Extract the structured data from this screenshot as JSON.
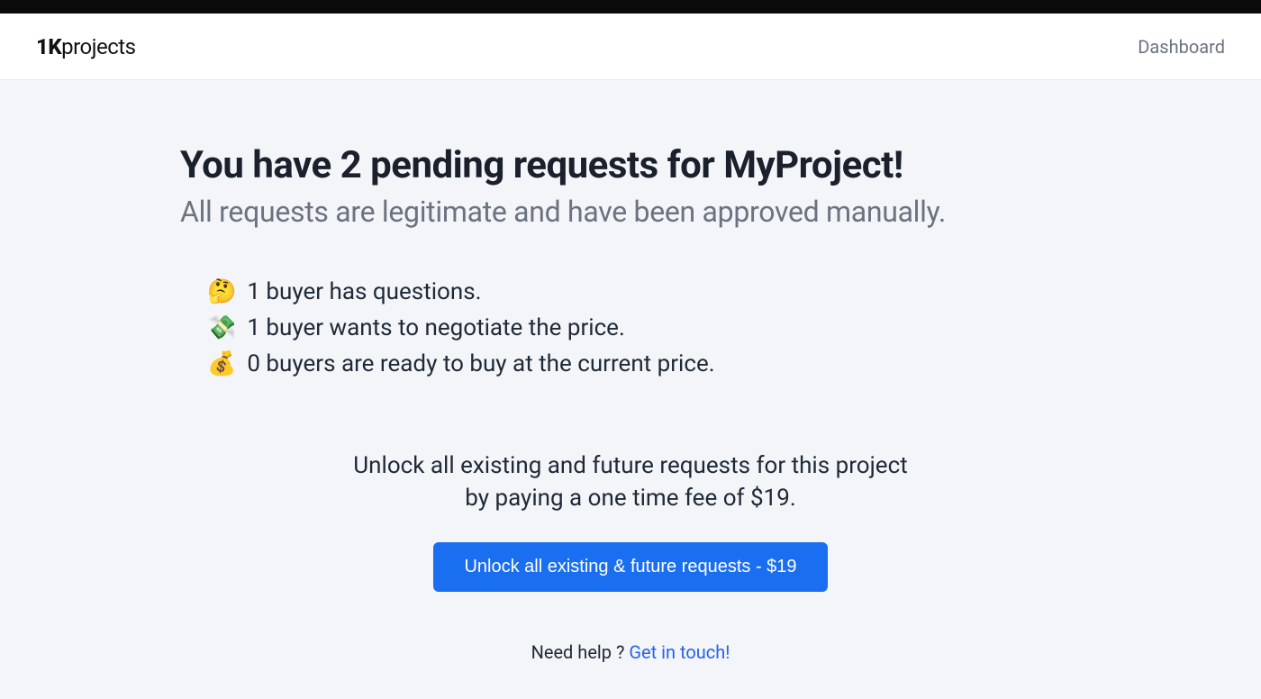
{
  "header": {
    "logo_bold": "1K",
    "logo_rest": "projects",
    "nav": {
      "dashboard": "Dashboard"
    }
  },
  "page": {
    "title": "You have 2 pending requests for MyProject!",
    "subtitle": "All requests are legitimate and have been approved manually.",
    "items": [
      {
        "icon": "🤔",
        "text": "1 buyer has questions."
      },
      {
        "icon": "💸",
        "text": "1 buyer wants to negotiate the price."
      },
      {
        "icon": "💰",
        "text": "0 buyers are ready to buy at the current price."
      }
    ],
    "cta": {
      "line1": "Unlock all existing and future requests for this project",
      "line2": "by paying a one time fee of $19.",
      "button_label": "Unlock all existing & future requests - $19"
    },
    "help": {
      "prefix": "Need help ? ",
      "link": "Get in touch!"
    }
  }
}
